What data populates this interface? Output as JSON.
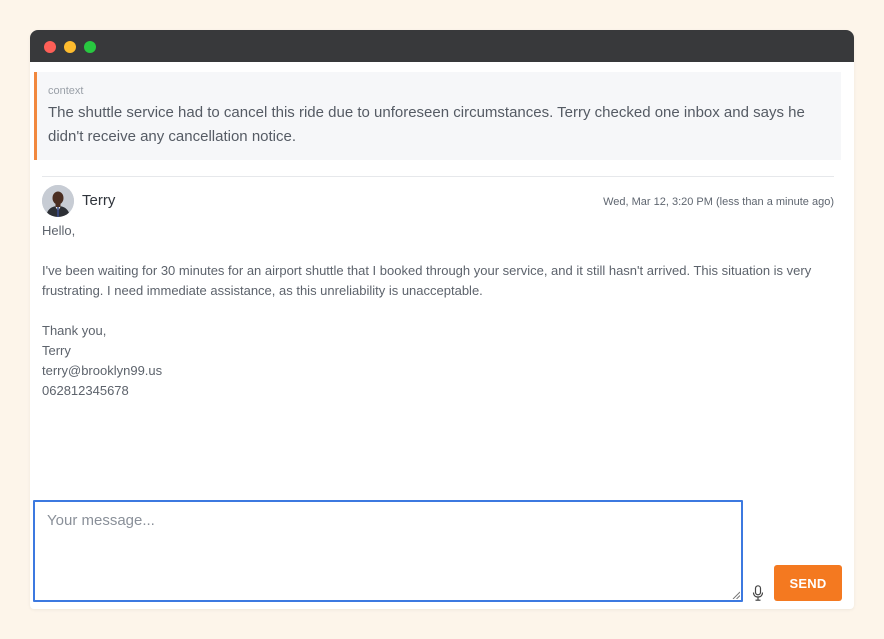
{
  "colors": {
    "page_background": "#fdf5ea",
    "titlebar": "#38393b",
    "accent": "#f47920",
    "focus_border": "#3c79e0"
  },
  "window": {
    "controls": [
      "close-icon",
      "minimize-icon",
      "maximize-icon"
    ]
  },
  "context": {
    "label": "context",
    "text": "The shuttle service had to cancel this ride due to unforeseen circumstances. Terry checked one inbox and says he didn't receive any cancellation notice."
  },
  "message": {
    "avatar_icon": "user-avatar",
    "sender": "Terry",
    "timestamp": "Wed, Mar 12, 3:20 PM (less than a minute ago)",
    "greeting": "Hello,",
    "paragraph": "I've been waiting for 30 minutes for an airport shuttle that I booked through your service, and it still hasn't arrived. This situation is very frustrating. I need immediate assistance, as this unreliability is unacceptable.",
    "closing": "Thank you,",
    "signature_name": "Terry",
    "signature_email": "terry@brooklyn99.us",
    "signature_phone": "062812345678"
  },
  "composer": {
    "value": "",
    "placeholder": "Your message...",
    "mic_icon": "microphone-icon",
    "send_label": "SEND"
  }
}
